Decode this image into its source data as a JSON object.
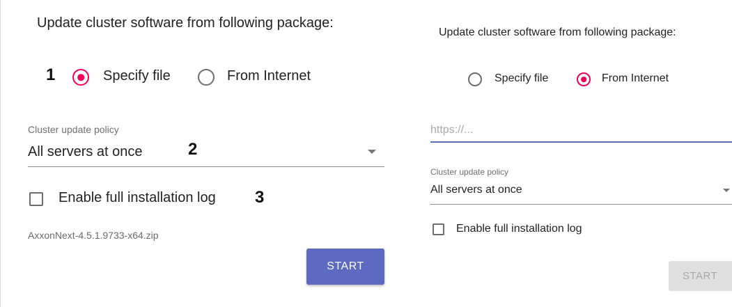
{
  "left_panel": {
    "title": "Update cluster software from following package:",
    "step_markers": [
      "1",
      "2",
      "3"
    ],
    "source_options": [
      {
        "label": "Specify file",
        "selected": true
      },
      {
        "label": "From Internet",
        "selected": false
      }
    ],
    "policy": {
      "label": "Cluster update policy",
      "value": "All servers at once"
    },
    "log_checkbox": {
      "label": "Enable full installation log",
      "checked": false
    },
    "file_name": "AxxonNext-4.5.1.9733-x64.zip",
    "start_label": "START"
  },
  "right_panel": {
    "title": "Update cluster software from following package:",
    "source_options": [
      {
        "label": "Specify file",
        "selected": false
      },
      {
        "label": "From Internet",
        "selected": true
      }
    ],
    "url": {
      "placeholder": "https://...",
      "value": ""
    },
    "policy": {
      "label": "Cluster update policy",
      "value": "All servers at once"
    },
    "log_checkbox": {
      "label": "Enable full installation log",
      "checked": false
    },
    "start_label": "START",
    "start_enabled": false
  },
  "colors": {
    "accent": "#f50057",
    "primary": "#5c6bc0",
    "disabled_bg": "#e0e0e0"
  }
}
